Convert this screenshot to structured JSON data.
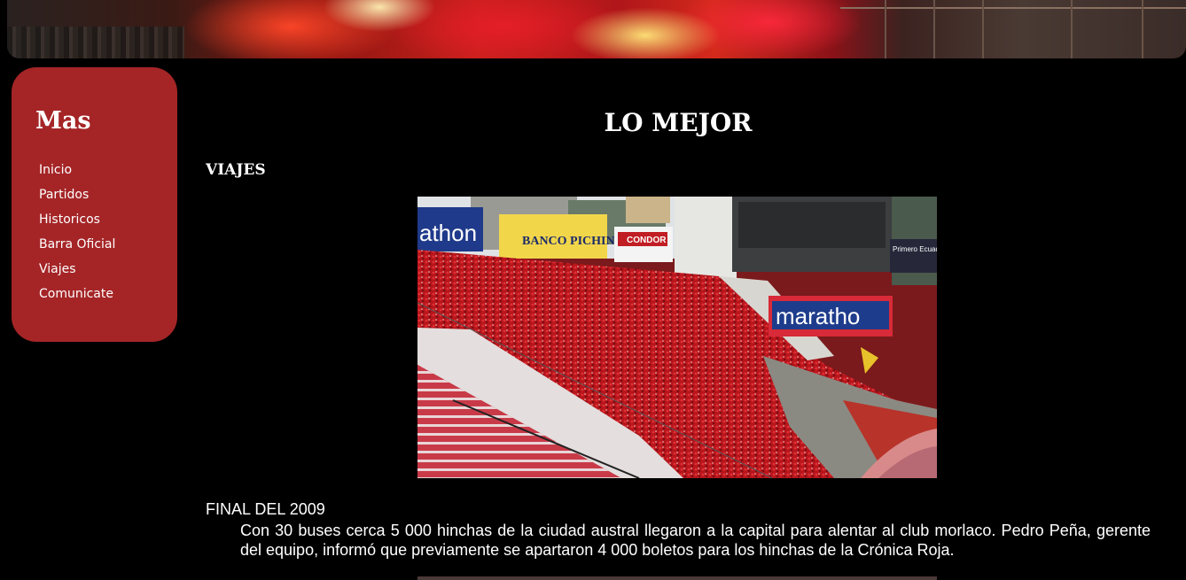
{
  "sidebar": {
    "title": "Mas",
    "items": [
      {
        "label": "Inicio"
      },
      {
        "label": "Partidos"
      },
      {
        "label": "Historicos"
      },
      {
        "label": "Barra Oficial"
      },
      {
        "label": "Viajes"
      },
      {
        "label": "Comunicate"
      }
    ]
  },
  "main": {
    "title": "LO MEJOR",
    "section_heading": "VIAJES",
    "photo": {
      "signs": [
        "athon",
        "BANCO PICHINCHA",
        "CONDOR",
        "maratho",
        "Primero Ecuador"
      ]
    },
    "caption_heading": "FINAL DEL 2009",
    "caption_body": "Con 30 buses cerca 5 000 hinchas de la ciudad austral llegaron a la capital para alentar al club morlaco. Pedro Peña, gerente del equipo, informó que previamente se apartaron 4 000 boletos para los hinchas de la Crónica Roja."
  },
  "colors": {
    "background": "#000000",
    "sidebar": "#a52527",
    "text": "#ffffff"
  }
}
